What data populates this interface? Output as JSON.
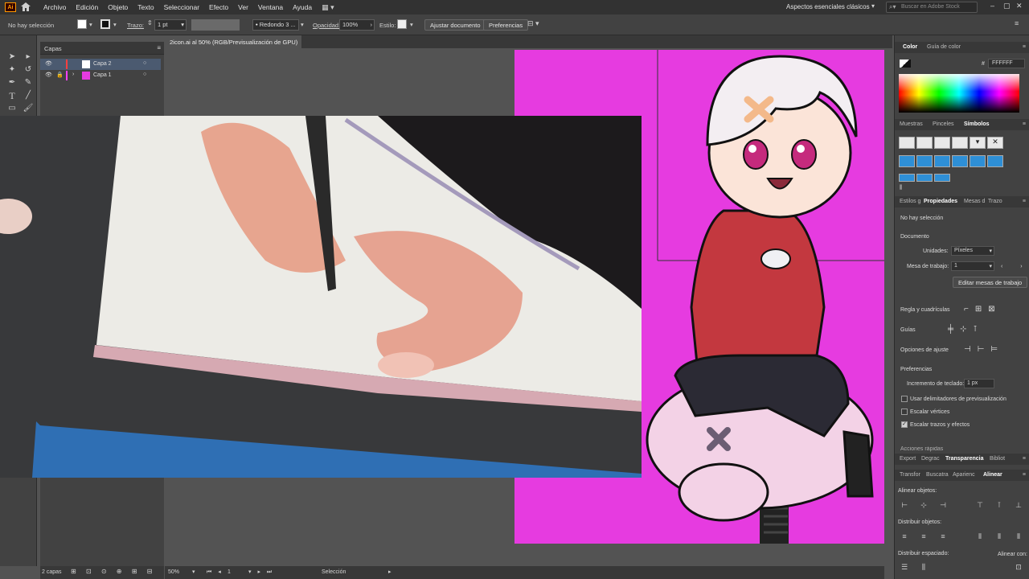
{
  "menubar": {
    "app_badge": "Ai",
    "items": [
      "Archivo",
      "Edición",
      "Objeto",
      "Texto",
      "Seleccionar",
      "Efecto",
      "Ver",
      "Ventana",
      "Ayuda"
    ],
    "workspace": "Aspectos esenciales clásicos",
    "stock_search_placeholder": "Buscar en Adobe Stock"
  },
  "control_bar": {
    "selection_state": "No hay selección",
    "stroke_label": "Trazo:",
    "stroke_weight": "1 pt",
    "brush_profile": "Redondo 3 ...",
    "opacity_label": "Opacidad:",
    "opacity_value": "100%",
    "style_label": "Estilo:",
    "fit_document_button": "Ajustar documento",
    "preferences_button": "Preferencias"
  },
  "layers_panel": {
    "tab": "Capas",
    "layers": [
      {
        "name": "Capa 2",
        "color": "#ff4040"
      },
      {
        "name": "Capa 1",
        "color": "#ff40ff"
      }
    ],
    "count": "2 capas"
  },
  "document": {
    "tab_title": "2icon.ai al 50% (RGB/Previsualización de GPU)",
    "artboard_color": "#e63be0"
  },
  "status_bar": {
    "zoom": "50%",
    "artboard_num": "1",
    "tool": "Selección"
  },
  "right_panel": {
    "color_tabs": [
      "Color",
      "Guía de color"
    ],
    "hex_value": "FFFFFF",
    "swatch_tabs": [
      "Muestras",
      "Pinceles",
      "Símbolos"
    ],
    "prop_tabs": [
      "Estilos g",
      "Propiedades",
      "Mesas d",
      "Trazo"
    ],
    "no_selection": "No hay selección",
    "document_heading": "Documento",
    "units_label": "Unidades:",
    "units_value": "Píxeles",
    "artboard_label": "Mesa de trabajo:",
    "artboard_value": "1",
    "edit_artboards_button": "Editar mesas de trabajo",
    "rulers_grids": "Regla y cuadrículas",
    "guides": "Guías",
    "snap_options": "Opciones de ajuste",
    "preferences_heading": "Preferencias",
    "keyboard_increment_label": "Incremento de teclado:",
    "keyboard_increment_value": "1 px",
    "checkboxes": [
      {
        "label": "Usar delimitadores de previsualización",
        "checked": false
      },
      {
        "label": "Escalar vértices",
        "checked": false
      },
      {
        "label": "Escalar trazos y efectos",
        "checked": true
      }
    ],
    "quick_actions": "Acciones rápidas",
    "bottom_tabs_1": [
      "Export",
      "Degrac",
      "Transparencia",
      "Bibliot"
    ],
    "bottom_tabs_2": [
      "Transfor",
      "Buscatra",
      "Aparienc",
      "Alinear"
    ],
    "align_objects": "Alinear objetos:",
    "distribute_objects": "Distribuir objetos:",
    "distribute_spacing": "Distribuir espaciado:",
    "align_to": "Alinear con:"
  }
}
